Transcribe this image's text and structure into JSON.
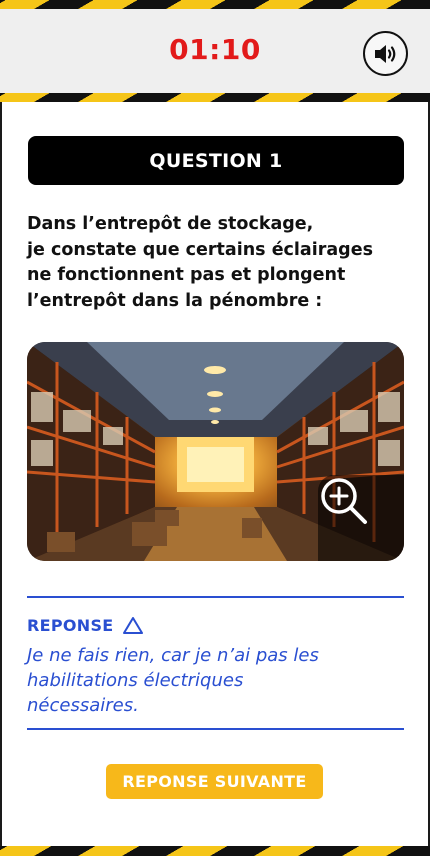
{
  "header": {
    "timer": "01:10",
    "sound_icon": "speaker-volume-icon"
  },
  "question": {
    "title": "QUESTION 1",
    "text": "Dans l’entrepôt de stockage,\nje constate que certains éclairages\nne fonctionnent pas et plongent\nl’entrepôt dans la pénombre :"
  },
  "image": {
    "zoom_icon": "zoom-in-icon"
  },
  "answer": {
    "label": "REPONSE",
    "warning_icon": "warning-triangle-icon",
    "text": "Je ne fais rien, car je n’ai pas les\nhabilitations électriques\nnécessaires."
  },
  "footer": {
    "next_label": "REPONSE SUIVANTE"
  },
  "colors": {
    "timer": "#e21a1a",
    "answer_accent": "#2a4fd1",
    "next_button": "#f7b81a",
    "hazard_yellow": "#f5c518"
  }
}
